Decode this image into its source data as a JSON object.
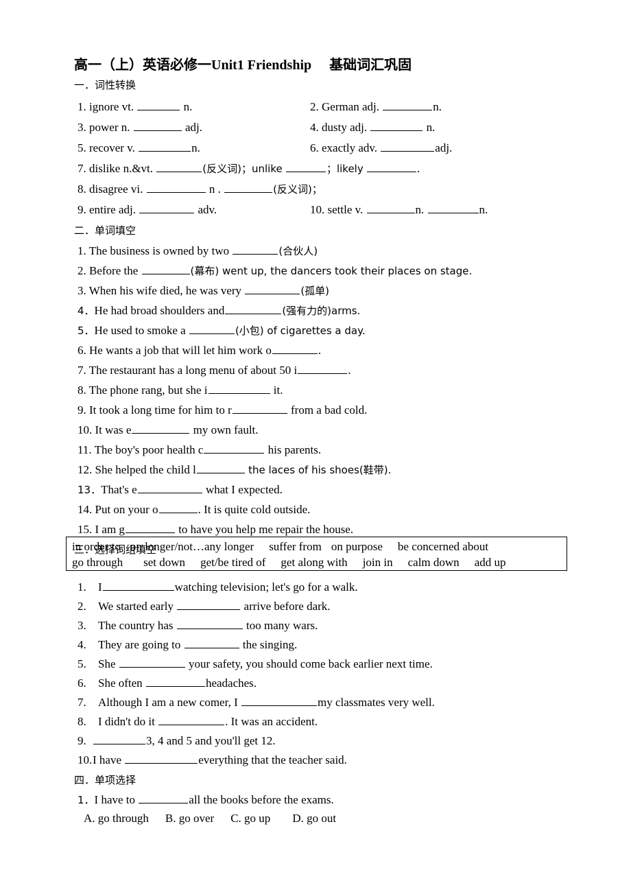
{
  "document": {
    "title_cn_1": "高一（上）英语必修一",
    "title_en": "Unit1 Friendship",
    "title_cn_2": "基础词汇巩固"
  },
  "sections": {
    "one": {
      "header": "一．词性转换",
      "items": [
        {
          "n": "1. ",
          "text": "ignore vt.",
          "blank": 62,
          "tail": "n."
        },
        {
          "n": "2. ",
          "text": "German adj.",
          "blank": 72,
          "tail": "n."
        },
        {
          "n": "3. ",
          "text": "power n.",
          "blank": 70,
          "tail": "adj."
        },
        {
          "n": "4. ",
          "text": "dusty adj.",
          "blank": 76,
          "tail": "n."
        },
        {
          "n": "5. ",
          "text": "recover v.",
          "blank": 76,
          "tail": "n."
        },
        {
          "n": "6. ",
          "text": "exactly adv.",
          "blank": 78,
          "tail": "adj."
        },
        {
          "n": "7. ",
          "text": "dislike n.&vt.",
          "blank": 66,
          "tail": "(反义词)；unlike"
        },
        {
          "n": "8. ",
          "text": "disagree vi.",
          "blank": 86,
          "tail": "n ."
        },
        {
          "n": "9. ",
          "text": "entire adj.",
          "blank": 80,
          "tail": "adv."
        },
        {
          "n": "10. ",
          "text": "settle v.",
          "blank": 70,
          "tail": "n."
        }
      ],
      "row7_mid_blank": 58,
      "row7_mid_text": "；likely",
      "row7_end_blank": 72,
      "row7_end_tail": ".",
      "row8_second_blank": 70,
      "row8_second_tail": "(反义词)；",
      "row10_second_blank": 74,
      "row10_second_tail": "n."
    },
    "two": {
      "header": "二．单词填空",
      "items": [
        {
          "num": "1. ",
          "pre": "The business is owned by two",
          "blank": 66,
          "post": "(合伙人)"
        },
        {
          "num": "2. ",
          "pre": "Before the",
          "blank": 70,
          "post": "(幕布) went up, the dancers took their places on stage."
        },
        {
          "num": "3. ",
          "pre": "When his wife died, he was very",
          "blank": 80,
          "post": "(孤单)"
        },
        {
          "num": "4．",
          "pre": "He had broad shoulders and",
          "blank": 82,
          "post": "(强有力的)arms."
        },
        {
          "num": "5．",
          "pre": "He used to smoke a",
          "blank": 66,
          "post": "(小包) of cigarettes a day."
        },
        {
          "num": "6. ",
          "pre": "He wants a job that will let him work o",
          "blank": 66,
          "post": "."
        },
        {
          "num": "7. ",
          "pre": "The restaurant has a long menu of about 50 i",
          "blank": 72,
          "post": "."
        },
        {
          "num": "8. ",
          "pre": "The phone rang, but she i",
          "blank": 90,
          "post": "it."
        },
        {
          "num": "9. ",
          "pre": "It took a long time for him to r",
          "blank": 80,
          "post": "from a bad cold."
        },
        {
          "num": "10. ",
          "pre": "It was e",
          "blank": 84,
          "post": "my own fault."
        },
        {
          "num": "11. ",
          "pre": "The boy's poor health c",
          "blank": 88,
          "post": "his parents."
        },
        {
          "num": "12. ",
          "pre": "She helped the child l",
          "blank": 70,
          "post": "the laces of his shoes(鞋带)."
        },
        {
          "num": "13．",
          "pre": "That's e",
          "blank": 94,
          "post": "what I expected."
        },
        {
          "num": "14. ",
          "pre": "Put on your o",
          "blank": 56,
          "post": ". It is quite cold outside."
        },
        {
          "num": "15. ",
          "pre": "I am g",
          "blank": 72,
          "post": "to have you help me repair the house."
        }
      ]
    },
    "three": {
      "header": "三．选择词组填空",
      "bank_line1": [
        "in order to",
        "on longer/not…any longer",
        "suffer from",
        "on purpose",
        "be concerned about"
      ],
      "bank_line2": [
        "go through",
        "set down",
        "get/be tired of",
        "get along with",
        "join in",
        "calm down",
        "add up"
      ],
      "items": [
        {
          "num": "1.",
          "pre": "I",
          "blank": 104,
          "post": "watching television; let's go for a walk."
        },
        {
          "num": "2.",
          "pre": "We started early",
          "blank": 92,
          "post": "arrive before dark."
        },
        {
          "num": "3.",
          "pre": "The country has",
          "blank": 96,
          "post": "too many wars."
        },
        {
          "num": "4.",
          "pre": "They are going to",
          "blank": 80,
          "post": "the singing."
        },
        {
          "num": "5.",
          "pre": "She",
          "blank": 96,
          "post": "your safety, you should come back earlier next time."
        },
        {
          "num": "6.",
          "pre": "She often",
          "blank": 86,
          "post": "headaches."
        },
        {
          "num": "7.",
          "pre": "Although I am a new comer, I",
          "blank": 110,
          "post": "my classmates very well."
        },
        {
          "num": "8.",
          "pre": "I didn't do it",
          "blank": 96,
          "post": ". It was an accident."
        },
        {
          "num": "9.",
          "pre": "",
          "blank": 76,
          "post": "3, 4 and 5 and you'll get 12."
        },
        {
          "num": "10.",
          "pre": "I have",
          "blank": 106,
          "post": "everything that the teacher said."
        }
      ]
    },
    "four": {
      "header": "四．单项选择",
      "question": {
        "num": "1．",
        "pre": "I have to",
        "blank": 72,
        "post": "all the books before the exams."
      },
      "options": [
        "A. go through",
        "B. go over",
        "C. go up",
        "D. go out"
      ]
    }
  }
}
